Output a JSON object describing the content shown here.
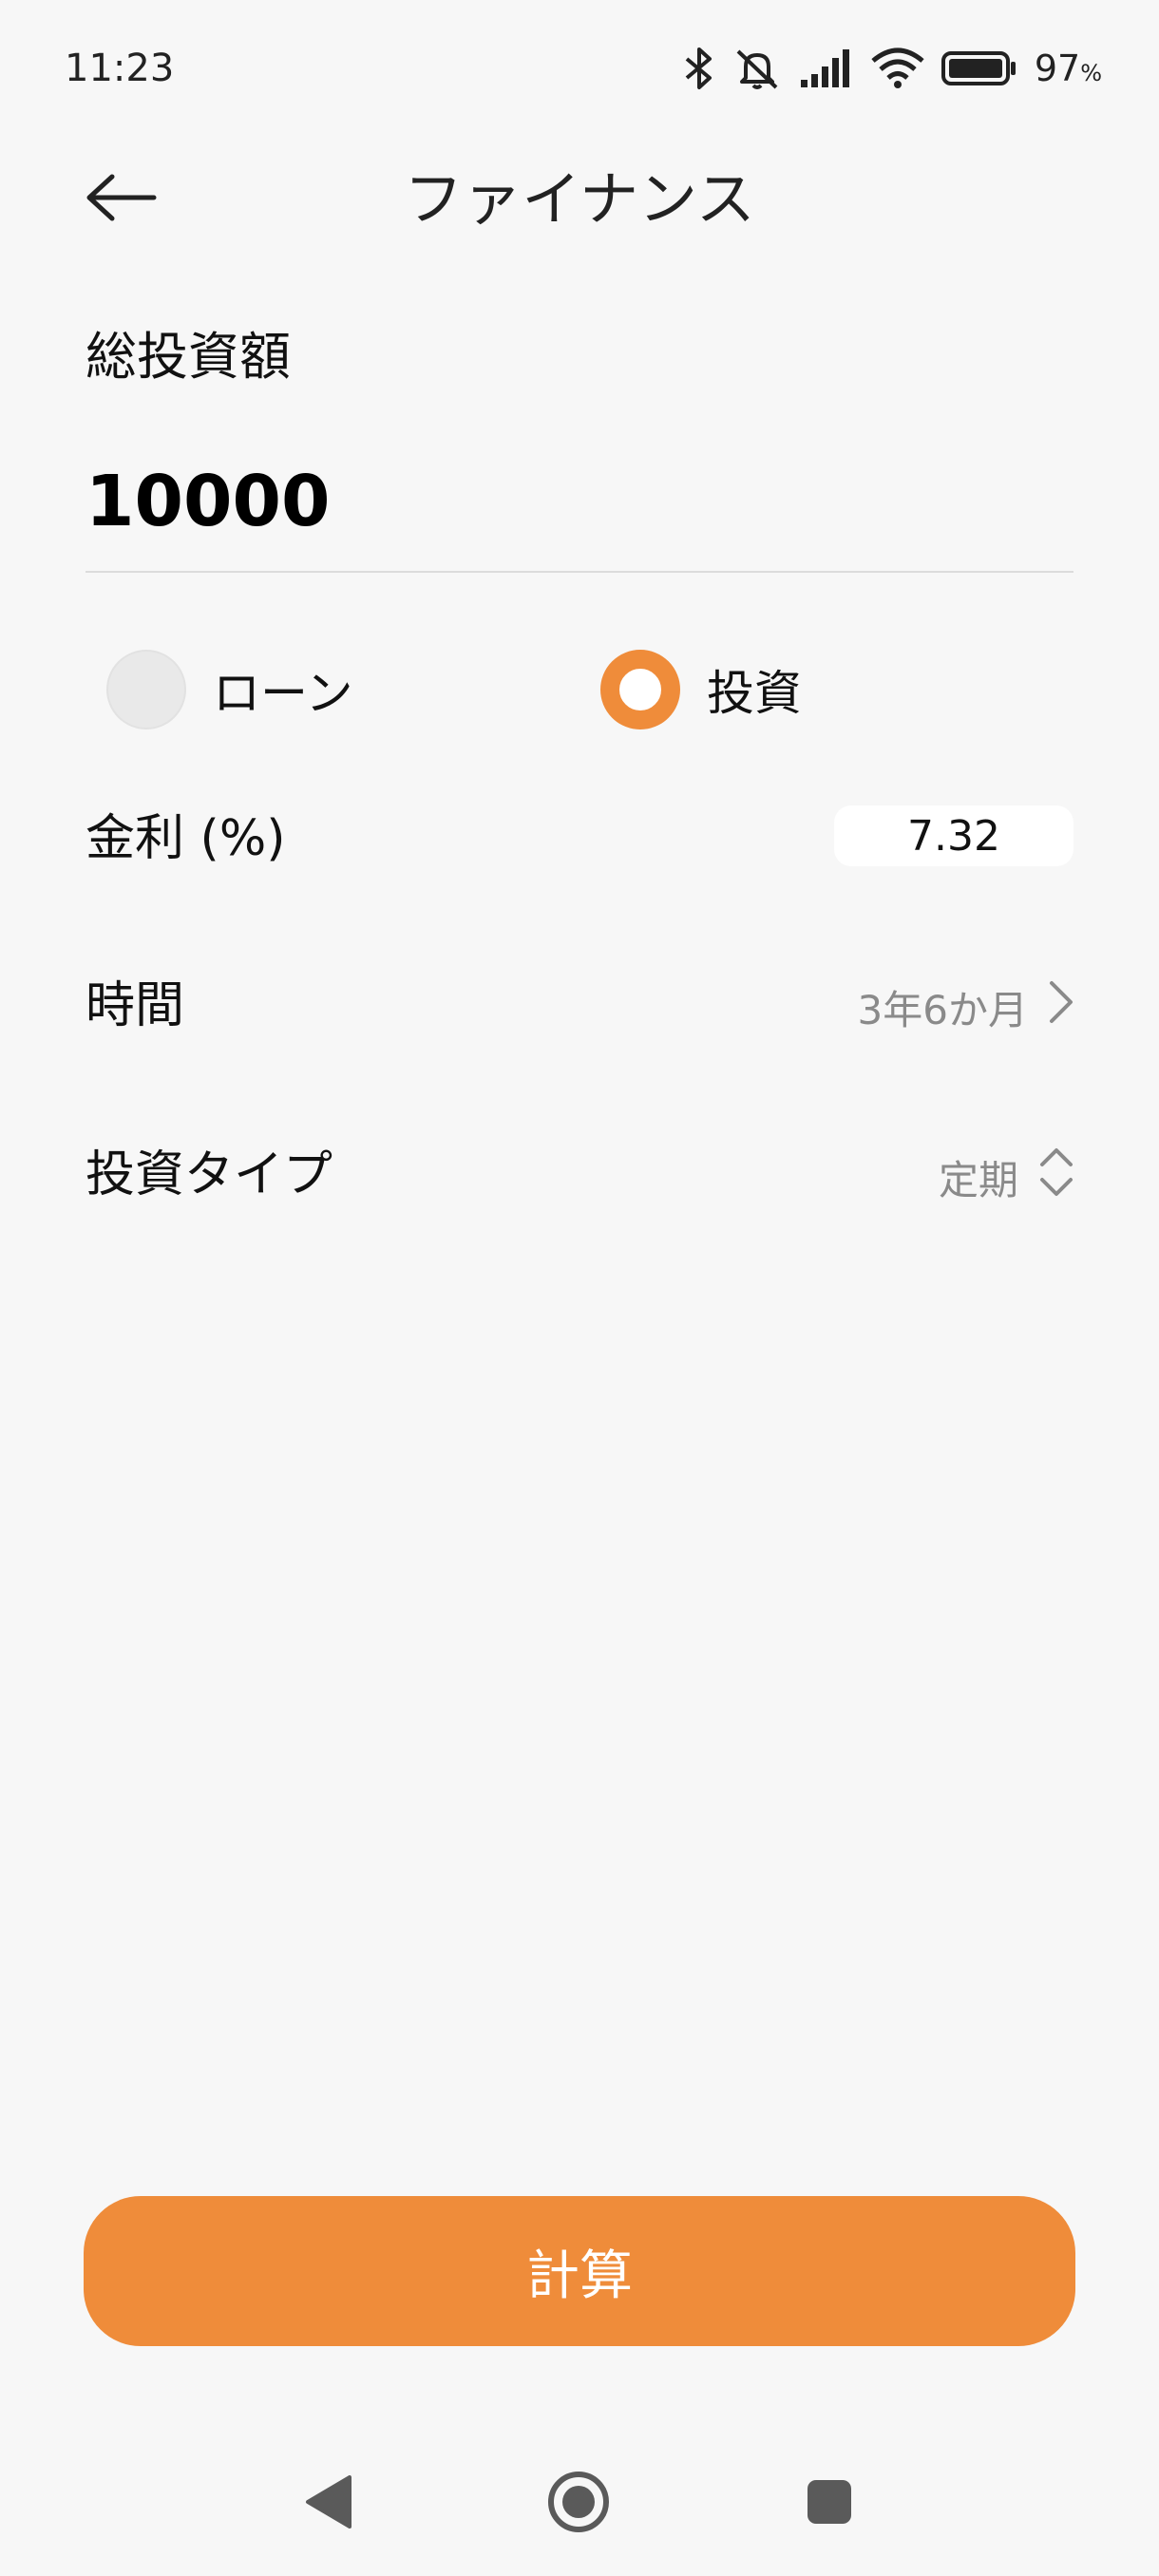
{
  "status_bar": {
    "time": "11:23",
    "battery_percent": "97",
    "battery_unit": "%",
    "icons": [
      "bluetooth-icon",
      "mute-icon",
      "signal-icon",
      "wifi-icon",
      "battery-icon"
    ]
  },
  "header": {
    "title": "ファイナンス",
    "back_icon": "back-arrow-icon"
  },
  "amount": {
    "label": "総投資額",
    "value": "10000"
  },
  "mode": {
    "options": [
      {
        "label": "ローン",
        "selected": false
      },
      {
        "label": "投資",
        "selected": true
      }
    ]
  },
  "interest": {
    "label": "金利 (%)",
    "value": "7.32"
  },
  "duration": {
    "label": "時間",
    "value": "3年6か月",
    "icon": "chevron-right-icon"
  },
  "investment_type": {
    "label": "投資タイプ",
    "value": "定期",
    "icon": "chevron-up-down-icon"
  },
  "calculate_button": {
    "label": "計算"
  },
  "colors": {
    "accent": "#ef8c3a",
    "background": "#f7f7f7"
  },
  "nav_bar": {
    "icons": [
      "back-triangle-icon",
      "home-circle-icon",
      "recents-square-icon"
    ]
  }
}
